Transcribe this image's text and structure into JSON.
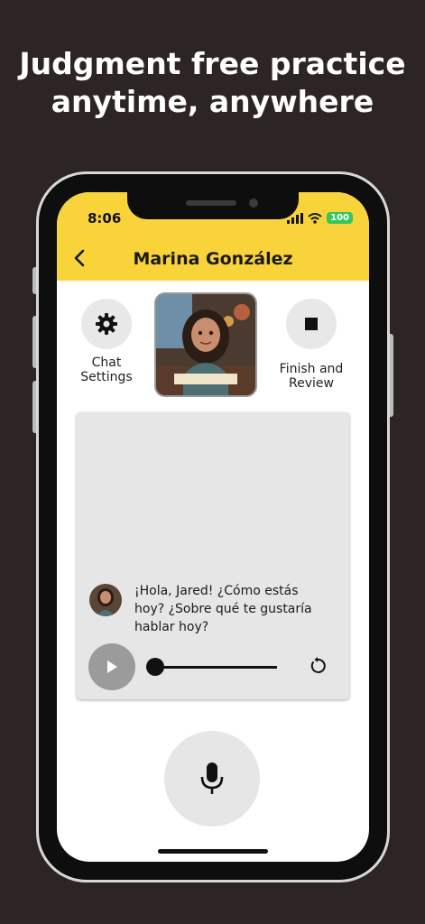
{
  "promo": {
    "headline_line1": "Judgment free practice",
    "headline_line2": "anytime, anywhere"
  },
  "status_bar": {
    "time": "8:06",
    "battery": "100"
  },
  "header": {
    "title": "Marina González",
    "back_icon": "chevron-left-icon"
  },
  "actions": {
    "settings_label_line1": "Chat",
    "settings_label_line2": "Settings",
    "finish_label_line1": "Finish and",
    "finish_label_line2": "Review"
  },
  "chat": {
    "message_line1": "¡Hola, Jared! ¿Cómo estás",
    "message_line2": "hoy? ¿Sobre qué te gustaría",
    "message_line3": "hablar hoy?",
    "audio_progress": 0
  },
  "colors": {
    "background": "#2d2523",
    "header": "#f8d33a",
    "battery": "#34c759"
  }
}
